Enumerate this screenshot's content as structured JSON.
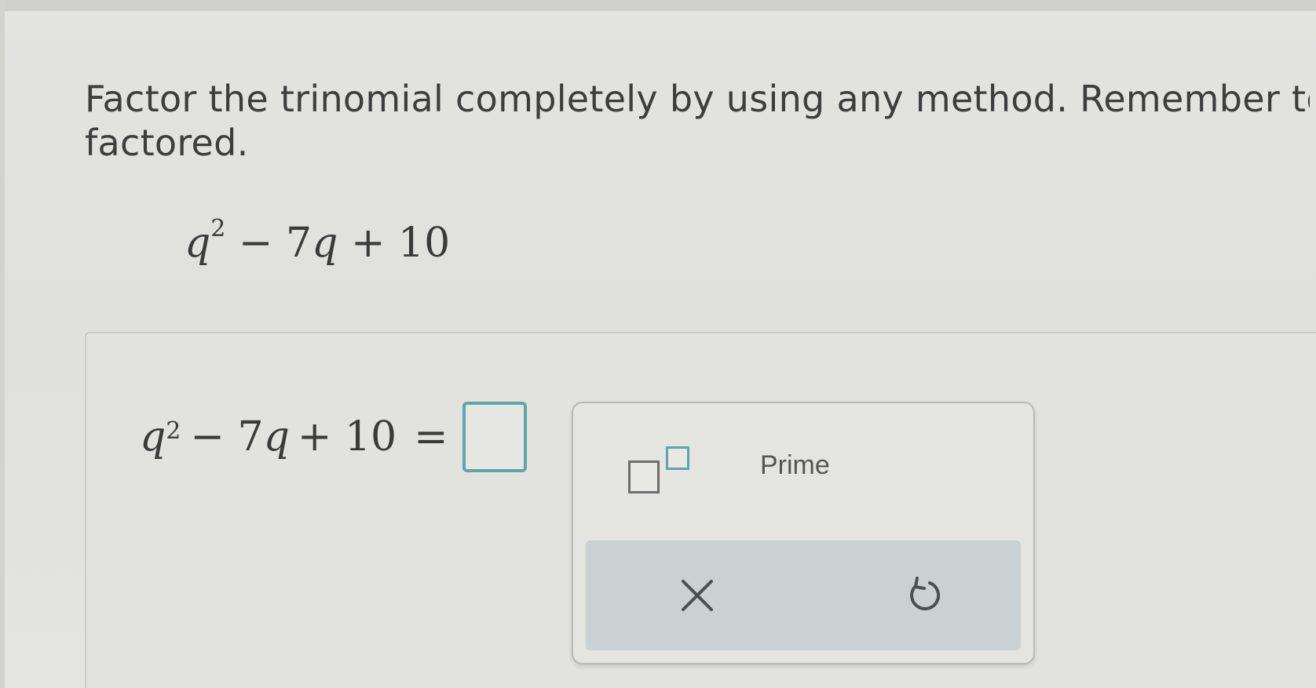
{
  "question": {
    "instruction_line1": "Factor the trinomial completely by using any method. Remember to l",
    "instruction_line2": "factored.",
    "expression": {
      "variable": "q",
      "exponent": "2",
      "middle_term": "− 7",
      "middle_variable": "q",
      "constant_term": "+ 10"
    }
  },
  "answer": {
    "lhs_variable": "q",
    "lhs_exponent": "2",
    "lhs_middle": "− 7",
    "lhs_middle_variable": "q",
    "lhs_constant": "+ 10",
    "equals": "="
  },
  "keypad": {
    "prime_label": "Prime",
    "icons": {
      "exponent": "exponent-template-icon",
      "clear": "close-icon",
      "undo": "undo-icon"
    }
  },
  "colors": {
    "accent": "#5fa5a7",
    "text": "#3d3d3d",
    "action_bar": "#c9d1d3"
  }
}
